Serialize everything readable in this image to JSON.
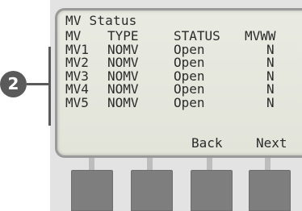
{
  "screen": {
    "title": "MV Status",
    "columns": {
      "mv": "MV",
      "type": "TYPE",
      "status": "STATUS",
      "mvww": "MVWW"
    },
    "rows": [
      {
        "mv": "MV1",
        "type": "NOMV",
        "status": "Open",
        "mvww": "N"
      },
      {
        "mv": "MV2",
        "type": "NOMV",
        "status": "Open",
        "mvww": "N"
      },
      {
        "mv": "MV3",
        "type": "NOMV",
        "status": "Open",
        "mvww": "N"
      },
      {
        "mv": "MV4",
        "type": "NOMV",
        "status": "Open",
        "mvww": "N"
      },
      {
        "mv": "MV5",
        "type": "NOMV",
        "status": "Open",
        "mvww": "N"
      }
    ],
    "softkeys": {
      "back": "Back",
      "next": "Next"
    }
  },
  "callout": {
    "number": "2"
  }
}
